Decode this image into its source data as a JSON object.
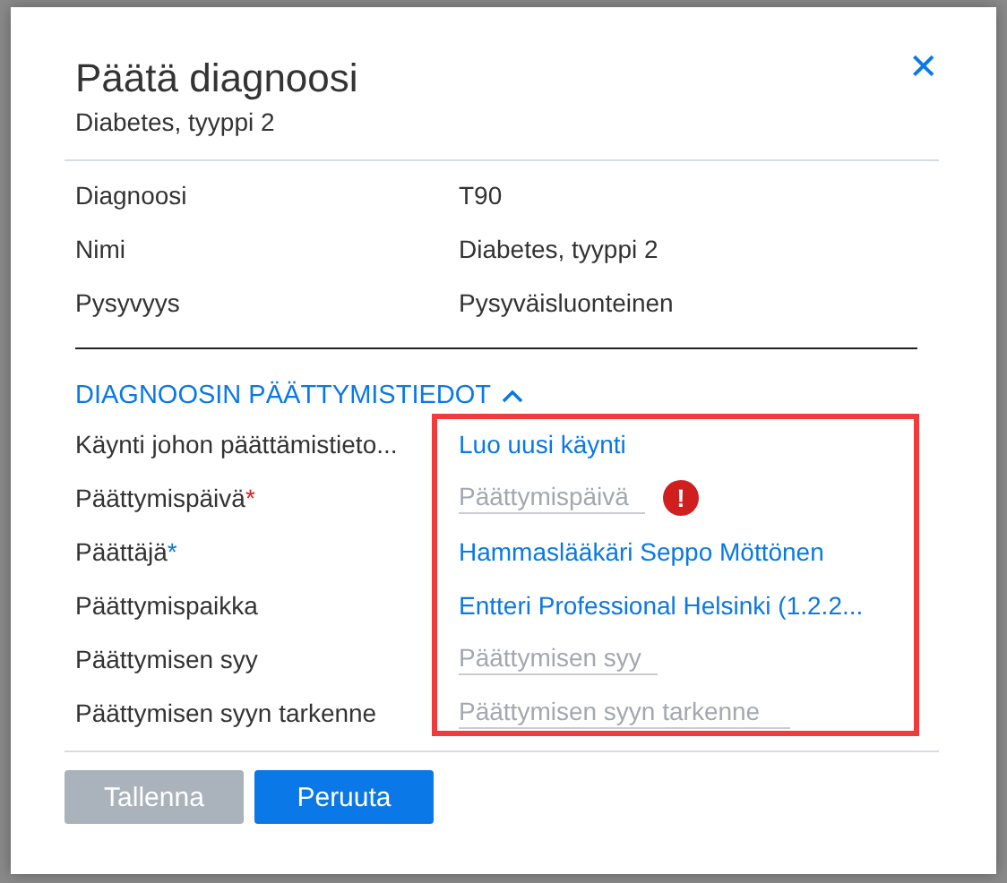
{
  "dialog": {
    "title": "Päätä diagnoosi",
    "subtitle": "Diabetes, tyyppi 2",
    "close": "✕"
  },
  "details": [
    {
      "label": "Diagnoosi",
      "value": "T90"
    },
    {
      "label": "Nimi",
      "value": "Diabetes, tyyppi 2"
    },
    {
      "label": "Pysyvyys",
      "value": "Pysyväisluonteinen"
    }
  ],
  "section": {
    "title": "DIAGNOOSIN PÄÄTTYMISTIEDOT",
    "expanded": true,
    "highlighted": true
  },
  "fields": [
    {
      "label": "Käynti johon päättämistieto...",
      "kind": "link",
      "value": "Luo uusi käynti",
      "error": false
    },
    {
      "label": "Päättymispäivä",
      "required_mark": "*",
      "color": "#e02020",
      "kind": "input",
      "placeholder": "Päättymispäivä",
      "error": true,
      "error_mark": "!"
    },
    {
      "label": "Päättäjä",
      "required_mark": "*",
      "color": "#0a78e6",
      "kind": "link",
      "value": "Hammaslääkäri Seppo Möttönen",
      "error": false
    },
    {
      "label": "Päättymispaikka",
      "kind": "link",
      "value": "Entteri Professional Helsinki (1.2.2...",
      "error": false
    },
    {
      "label": "Päättymisen syy",
      "kind": "input",
      "placeholder": "Päättymisen syy",
      "error": false
    },
    {
      "label": "Päättymisen syyn tarkenne",
      "kind": "input",
      "placeholder": "Päättymisen syyn tarkenne",
      "error": false
    }
  ],
  "buttons": [
    {
      "label": "Tallenna",
      "disabled": true
    },
    {
      "label": "Peruuta",
      "disabled": false
    }
  ]
}
